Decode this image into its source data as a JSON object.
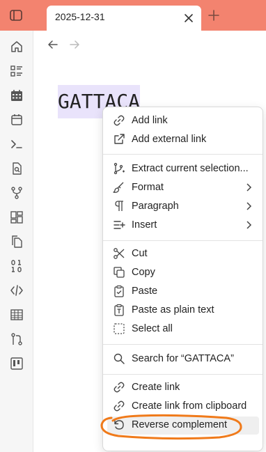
{
  "tab": {
    "title": "2025-12-31"
  },
  "editor": {
    "selected_text": "GATTACA"
  },
  "ribbon": {
    "items": [
      {
        "icon": "home-icon"
      },
      {
        "icon": "list-icon"
      },
      {
        "icon": "calendar-grid-icon"
      },
      {
        "icon": "calendar-icon"
      },
      {
        "icon": "terminal-icon"
      },
      {
        "icon": "search-file-icon"
      },
      {
        "icon": "git-branch-icon"
      },
      {
        "icon": "dashboard-icon"
      },
      {
        "icon": "copy-pages-icon"
      },
      {
        "icon": "binary-icon"
      },
      {
        "icon": "code-icon"
      },
      {
        "icon": "table-icon"
      },
      {
        "icon": "git-compare-icon"
      },
      {
        "icon": "kanban-icon"
      }
    ]
  },
  "menu": {
    "add_link": "Add link",
    "add_external_link": "Add external link",
    "extract_selection": "Extract current selection...",
    "format": "Format",
    "paragraph": "Paragraph",
    "insert": "Insert",
    "cut": "Cut",
    "copy": "Copy",
    "paste": "Paste",
    "paste_plain": "Paste as plain text",
    "select_all": "Select all",
    "search_for": "Search for “GATTACA”",
    "create_link": "Create link",
    "create_link_clipboard": "Create link from clipboard",
    "reverse_complement": "Reverse complement"
  },
  "colors": {
    "titlebar": "#f3836f",
    "selection": "#e9e3fb",
    "annotation": "#f07a1a"
  }
}
